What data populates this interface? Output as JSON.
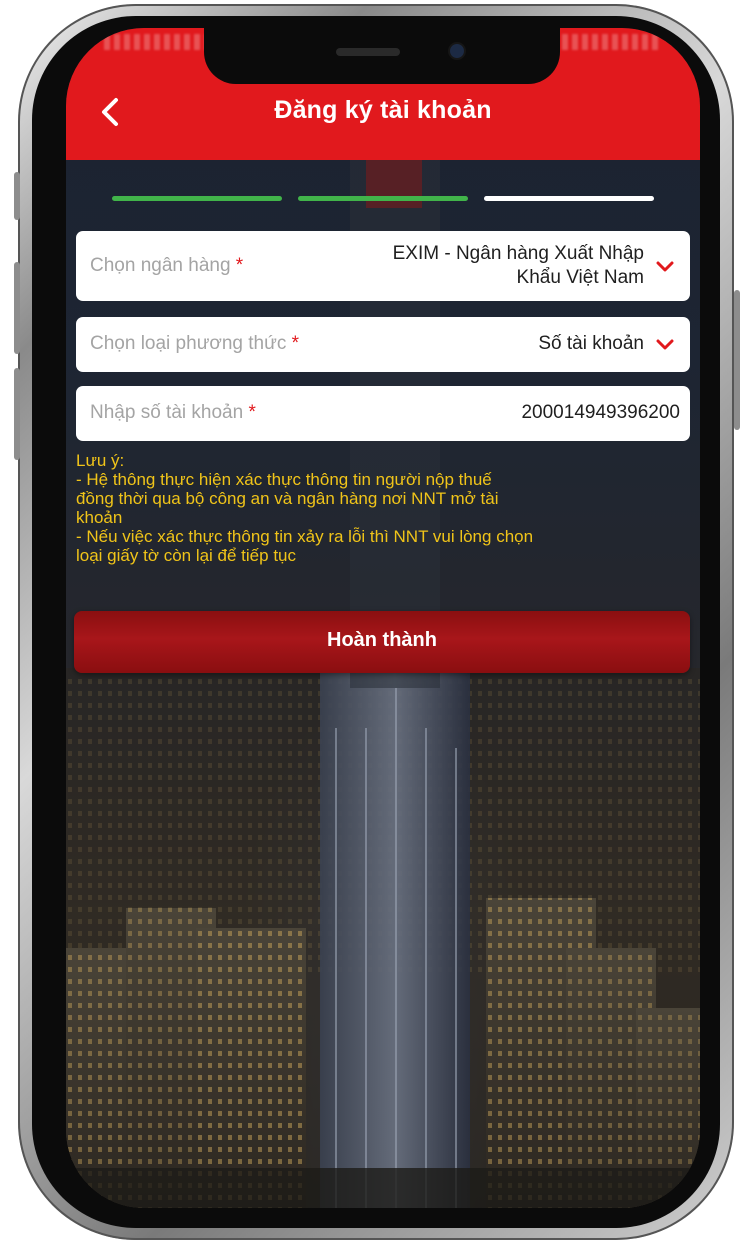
{
  "header": {
    "title": "Đăng ký tài khoản"
  },
  "progress": {
    "total_steps": 3,
    "completed_steps": 2,
    "active_color": "#41b44a",
    "inactive_color": "#ffffff"
  },
  "form": {
    "bank": {
      "label": "Chọn ngân hàng",
      "value_line1": "EXIM - Ngân hàng Xuất Nhập",
      "value_line2": "Khẩu Việt Nam"
    },
    "method": {
      "label": "Chọn loại phương thức",
      "value": "Số tài khoản"
    },
    "account": {
      "label": "Nhập số tài khoản",
      "value": "200014949396200"
    },
    "required_mark": "*"
  },
  "note": {
    "title": "Lưu ý:",
    "lines": [
      "- Hệ thông thực hiện xác thực thông tin người nộp thuế",
      "đồng thời qua bộ công an và ngân hàng nơi NNT mở tài",
      "khoản",
      "- Nếu việc xác thực thông tin xảy ra lỗi thì NNT vui lòng chọn",
      "loại giấy tờ còn lại để tiếp tục"
    ]
  },
  "submit_label": "Hoàn thành",
  "colors": {
    "brand_red": "#e1191d",
    "note_yellow": "#f0c419",
    "button_red": "#a8161a"
  }
}
